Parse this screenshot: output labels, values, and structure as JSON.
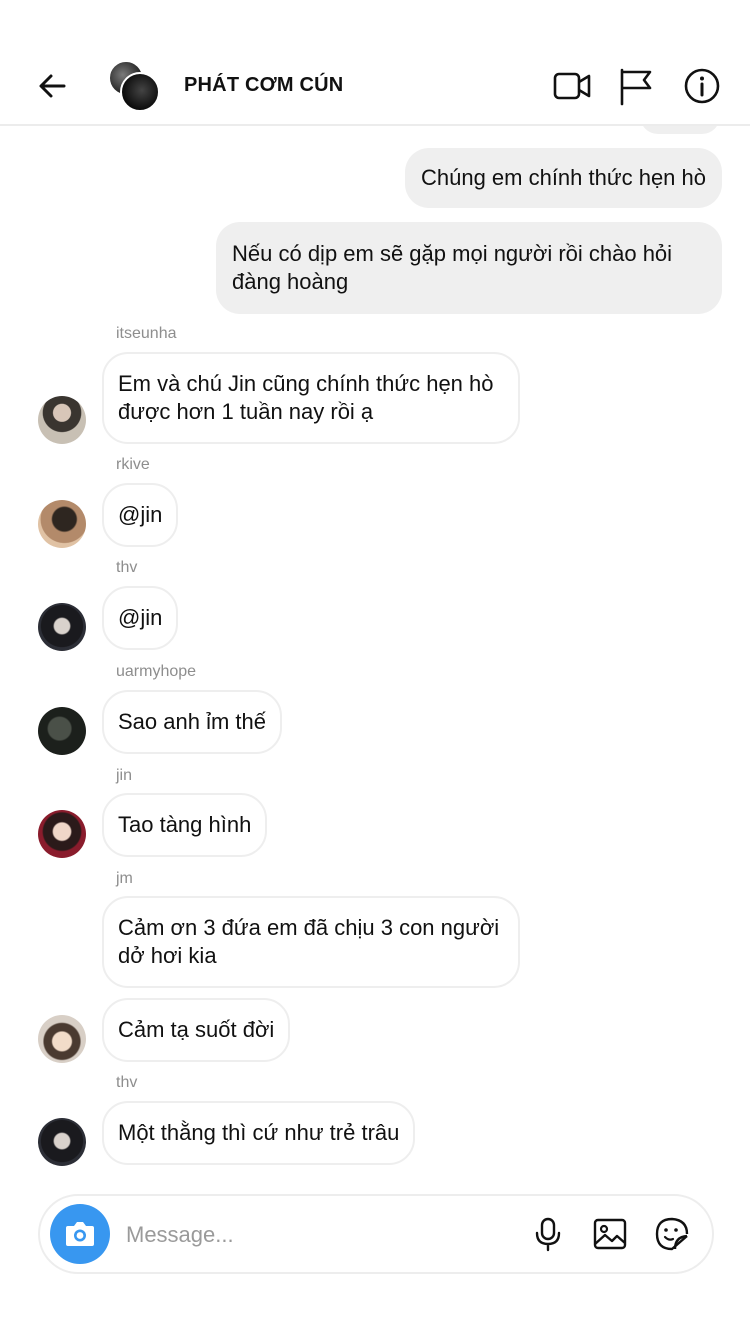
{
  "header": {
    "title": "PHÁT CƠM CÚN",
    "icons": [
      "back-arrow-icon",
      "video-call-icon",
      "flag-icon",
      "info-icon"
    ]
  },
  "outgoing": [
    {
      "text": "Chúng em chính thức hẹn hò"
    },
    {
      "text": "Nếu có dịp em sẽ gặp mọi người rồi chào hỏi đàng hoàng"
    }
  ],
  "incoming": [
    {
      "sender": "itseunha",
      "text": "Em và chú Jin cũng chính thức hẹn hò được hơn 1 tuần nay rồi ạ"
    },
    {
      "sender": "rkive",
      "text": "@jin"
    },
    {
      "sender": "thv",
      "text": "@jin"
    },
    {
      "sender": "uarmyhope",
      "text": "Sao anh ỉm thế"
    },
    {
      "sender": "jin",
      "text": "Tao tàng hình"
    },
    {
      "sender": "jm",
      "text": "Cảm ơn 3 đứa em đã chịu 3 con người dở hơi kia"
    },
    {
      "sender": "",
      "text": "Cảm tạ suốt đời"
    },
    {
      "sender": "thv",
      "text": "Một thằng thì cứ như trẻ trâu"
    }
  ],
  "composer": {
    "placeholder": "Message...",
    "icons": [
      "camera-icon",
      "microphone-icon",
      "gallery-icon",
      "sticker-icon"
    ]
  },
  "colors": {
    "accent": "#3897f0",
    "outgoing_bubble": "#efefef",
    "incoming_border": "#eeeeee"
  }
}
